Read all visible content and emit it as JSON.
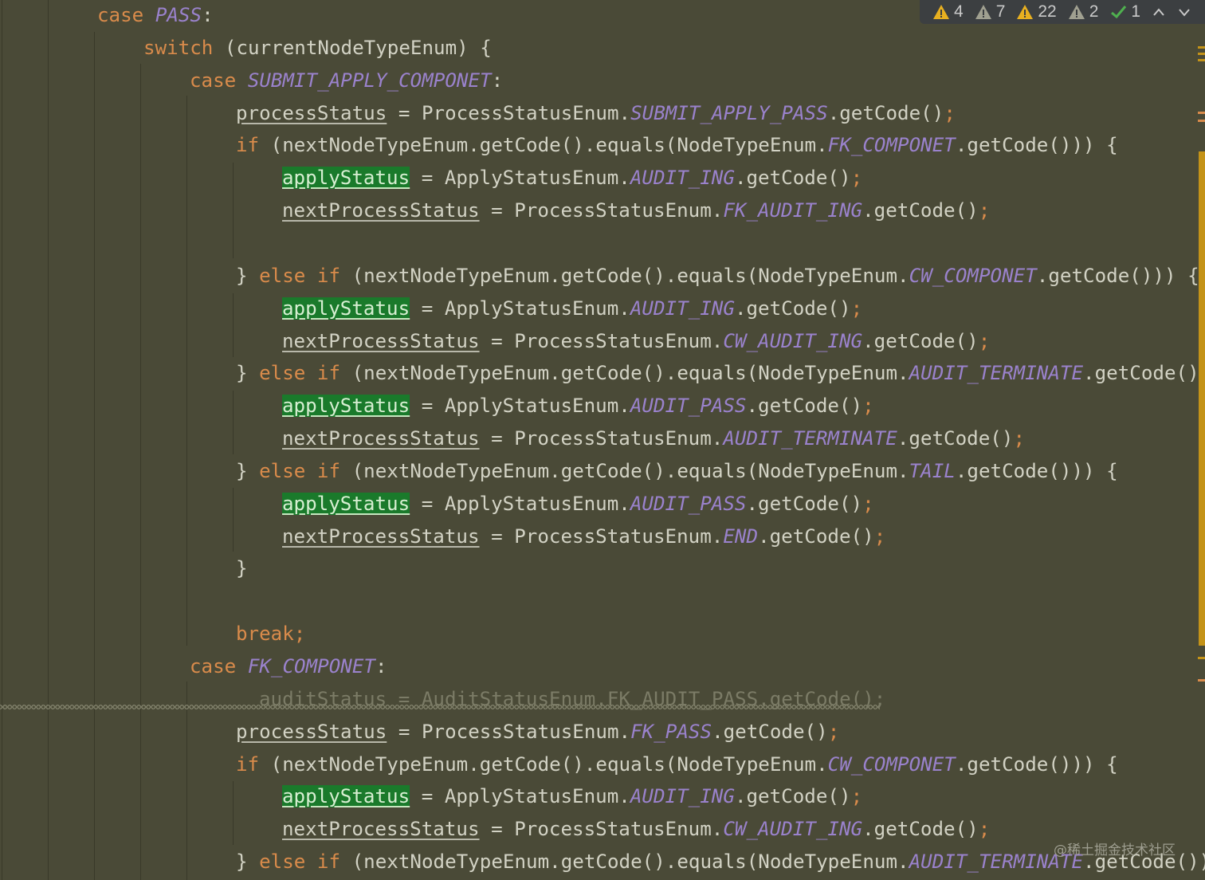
{
  "editor": {
    "lines": [
      {
        "indent": 2,
        "tokens": [
          {
            "t": "case ",
            "c": "kw"
          },
          {
            "t": "PASS",
            "c": "cst"
          },
          {
            "t": ":",
            "c": "pl"
          }
        ]
      },
      {
        "indent": 3,
        "tokens": [
          {
            "t": "switch",
            "c": "kw"
          },
          {
            "t": " (currentNodeTypeEnum) {",
            "c": "pl"
          }
        ]
      },
      {
        "indent": 4,
        "tokens": [
          {
            "t": "case ",
            "c": "kw"
          },
          {
            "t": "SUBMIT_APPLY_COMPONET",
            "c": "cst"
          },
          {
            "t": ":",
            "c": "pl"
          }
        ]
      },
      {
        "indent": 5,
        "tokens": [
          {
            "t": "processStatus",
            "c": "fld"
          },
          {
            "t": " = ProcessStatusEnum.",
            "c": "pl"
          },
          {
            "t": "SUBMIT_APPLY_PASS",
            "c": "cst"
          },
          {
            "t": ".getCode()",
            "c": "pl"
          },
          {
            "t": ";",
            "c": "semi"
          }
        ]
      },
      {
        "indent": 5,
        "tokens": [
          {
            "t": "if",
            "c": "kw"
          },
          {
            "t": " (nextNodeTypeEnum.getCode().equals(NodeTypeEnum.",
            "c": "pl"
          },
          {
            "t": "FK_COMPONET",
            "c": "cst"
          },
          {
            "t": ".getCode())) {",
            "c": "pl"
          }
        ]
      },
      {
        "indent": 6,
        "tokens": [
          {
            "t": "applyStatus",
            "c": "hl"
          },
          {
            "t": " = ApplyStatusEnum.",
            "c": "pl"
          },
          {
            "t": "AUDIT_ING",
            "c": "cst"
          },
          {
            "t": ".getCode()",
            "c": "pl"
          },
          {
            "t": ";",
            "c": "semi"
          }
        ]
      },
      {
        "indent": 6,
        "tokens": [
          {
            "t": "nextProcessStatus",
            "c": "fld"
          },
          {
            "t": " = ProcessStatusEnum.",
            "c": "pl"
          },
          {
            "t": "FK_AUDIT_ING",
            "c": "cst"
          },
          {
            "t": ".getCode()",
            "c": "pl"
          },
          {
            "t": ";",
            "c": "semi"
          }
        ]
      },
      {
        "indent": 0,
        "tokens": []
      },
      {
        "indent": 5,
        "tokens": [
          {
            "t": "} ",
            "c": "pl"
          },
          {
            "t": "else if",
            "c": "kw"
          },
          {
            "t": " (nextNodeTypeEnum.getCode().equals(NodeTypeEnum.",
            "c": "pl"
          },
          {
            "t": "CW_COMPONET",
            "c": "cst"
          },
          {
            "t": ".getCode())) {",
            "c": "pl"
          }
        ]
      },
      {
        "indent": 6,
        "tokens": [
          {
            "t": "applyStatus",
            "c": "hl"
          },
          {
            "t": " = ApplyStatusEnum.",
            "c": "pl"
          },
          {
            "t": "AUDIT_ING",
            "c": "cst"
          },
          {
            "t": ".getCode()",
            "c": "pl"
          },
          {
            "t": ";",
            "c": "semi"
          }
        ]
      },
      {
        "indent": 6,
        "tokens": [
          {
            "t": "nextProcessStatus",
            "c": "fld"
          },
          {
            "t": " = ProcessStatusEnum.",
            "c": "pl"
          },
          {
            "t": "CW_AUDIT_ING",
            "c": "cst"
          },
          {
            "t": ".getCode()",
            "c": "pl"
          },
          {
            "t": ";",
            "c": "semi"
          }
        ]
      },
      {
        "indent": 5,
        "tokens": [
          {
            "t": "} ",
            "c": "pl"
          },
          {
            "t": "else if",
            "c": "kw"
          },
          {
            "t": " (nextNodeTypeEnum.getCode().equals(NodeTypeEnum.",
            "c": "pl"
          },
          {
            "t": "AUDIT_TERMINATE",
            "c": "cst"
          },
          {
            "t": ".getCode()))",
            "c": "pl"
          }
        ]
      },
      {
        "indent": 6,
        "tokens": [
          {
            "t": "applyStatus",
            "c": "hl"
          },
          {
            "t": " = ApplyStatusEnum.",
            "c": "pl"
          },
          {
            "t": "AUDIT_PASS",
            "c": "cst"
          },
          {
            "t": ".getCode()",
            "c": "pl"
          },
          {
            "t": ";",
            "c": "semi"
          }
        ]
      },
      {
        "indent": 6,
        "tokens": [
          {
            "t": "nextProcessStatus",
            "c": "fld"
          },
          {
            "t": " = ProcessStatusEnum.",
            "c": "pl"
          },
          {
            "t": "AUDIT_TERMINATE",
            "c": "cst"
          },
          {
            "t": ".getCode()",
            "c": "pl"
          },
          {
            "t": ";",
            "c": "semi"
          }
        ]
      },
      {
        "indent": 5,
        "tokens": [
          {
            "t": "} ",
            "c": "pl"
          },
          {
            "t": "else if",
            "c": "kw"
          },
          {
            "t": " (nextNodeTypeEnum.getCode().equals(NodeTypeEnum.",
            "c": "pl"
          },
          {
            "t": "TAIL",
            "c": "cst"
          },
          {
            "t": ".getCode())) {",
            "c": "pl"
          }
        ]
      },
      {
        "indent": 6,
        "tokens": [
          {
            "t": "applyStatus",
            "c": "hl"
          },
          {
            "t": " = ApplyStatusEnum.",
            "c": "pl"
          },
          {
            "t": "AUDIT_PASS",
            "c": "cst"
          },
          {
            "t": ".getCode()",
            "c": "pl"
          },
          {
            "t": ";",
            "c": "semi"
          }
        ]
      },
      {
        "indent": 6,
        "tokens": [
          {
            "t": "nextProcessStatus",
            "c": "fld"
          },
          {
            "t": " = ProcessStatusEnum.",
            "c": "pl"
          },
          {
            "t": "END",
            "c": "cst"
          },
          {
            "t": ".getCode()",
            "c": "pl"
          },
          {
            "t": ";",
            "c": "semi"
          }
        ]
      },
      {
        "indent": 5,
        "tokens": [
          {
            "t": "}",
            "c": "pl"
          }
        ]
      },
      {
        "indent": 0,
        "tokens": []
      },
      {
        "indent": 5,
        "tokens": [
          {
            "t": "break;",
            "c": "kw"
          }
        ]
      },
      {
        "indent": 4,
        "tokens": [
          {
            "t": "case ",
            "c": "kw"
          },
          {
            "t": "FK_COMPONET",
            "c": "cst"
          },
          {
            "t": ":",
            "c": "pl"
          }
        ]
      },
      {
        "indent": 5.5,
        "tokens": [
          {
            "t": "auditStatus = AuditStatusEnum.FK_AUDIT_PASS.getCode();",
            "c": "dim"
          }
        ]
      },
      {
        "indent": 5,
        "tokens": [
          {
            "t": "processStatus",
            "c": "fld"
          },
          {
            "t": " = ProcessStatusEnum.",
            "c": "pl"
          },
          {
            "t": "FK_PASS",
            "c": "cst"
          },
          {
            "t": ".getCode()",
            "c": "pl"
          },
          {
            "t": ";",
            "c": "semi"
          }
        ]
      },
      {
        "indent": 5,
        "tokens": [
          {
            "t": "if",
            "c": "kw"
          },
          {
            "t": " (nextNodeTypeEnum.getCode().equals(NodeTypeEnum.",
            "c": "pl"
          },
          {
            "t": "CW_COMPONET",
            "c": "cst"
          },
          {
            "t": ".getCode())) {",
            "c": "pl"
          }
        ]
      },
      {
        "indent": 6,
        "tokens": [
          {
            "t": "applyStatus",
            "c": "hl"
          },
          {
            "t": " = ApplyStatusEnum.",
            "c": "pl"
          },
          {
            "t": "AUDIT_ING",
            "c": "cst"
          },
          {
            "t": ".getCode()",
            "c": "pl"
          },
          {
            "t": ";",
            "c": "semi"
          }
        ]
      },
      {
        "indent": 6,
        "tokens": [
          {
            "t": "nextProcessStatus",
            "c": "fld"
          },
          {
            "t": " = ProcessStatusEnum.",
            "c": "pl"
          },
          {
            "t": "CW_AUDIT_ING",
            "c": "cst"
          },
          {
            "t": ".getCode()",
            "c": "pl"
          },
          {
            "t": ";",
            "c": "semi"
          }
        ]
      },
      {
        "indent": 5,
        "tokens": [
          {
            "t": "} ",
            "c": "pl"
          },
          {
            "t": "else if",
            "c": "kw"
          },
          {
            "t": " (nextNodeTypeEnum.getCode().equals(NodeTypeEnum.",
            "c": "pl"
          },
          {
            "t": "AUDIT_TERMINATE",
            "c": "cst"
          },
          {
            "t": ".getCode())",
            "c": "pl"
          }
        ]
      }
    ]
  },
  "inspections": {
    "items": [
      {
        "icon": "error-warning-icon",
        "count": "4",
        "color": "#e8b020"
      },
      {
        "icon": "weak-warning-icon",
        "count": "7",
        "color": "#a0a090"
      },
      {
        "icon": "warning-icon",
        "count": "22",
        "color": "#e8b020"
      },
      {
        "icon": "typo-warning-icon",
        "count": "2",
        "color": "#a0a090"
      },
      {
        "icon": "check-icon",
        "count": "1",
        "color": "#4fb04f"
      }
    ],
    "prev_icon": "chevron-up-icon",
    "next_icon": "chevron-down-icon"
  },
  "watermark": "@稀土掘金技术社区",
  "colors": {
    "background": "#4a4a37",
    "keyword": "#d98b4b",
    "constant": "#9a82cc",
    "text": "#d2d2c4",
    "highlight": "#1a7a2b"
  }
}
